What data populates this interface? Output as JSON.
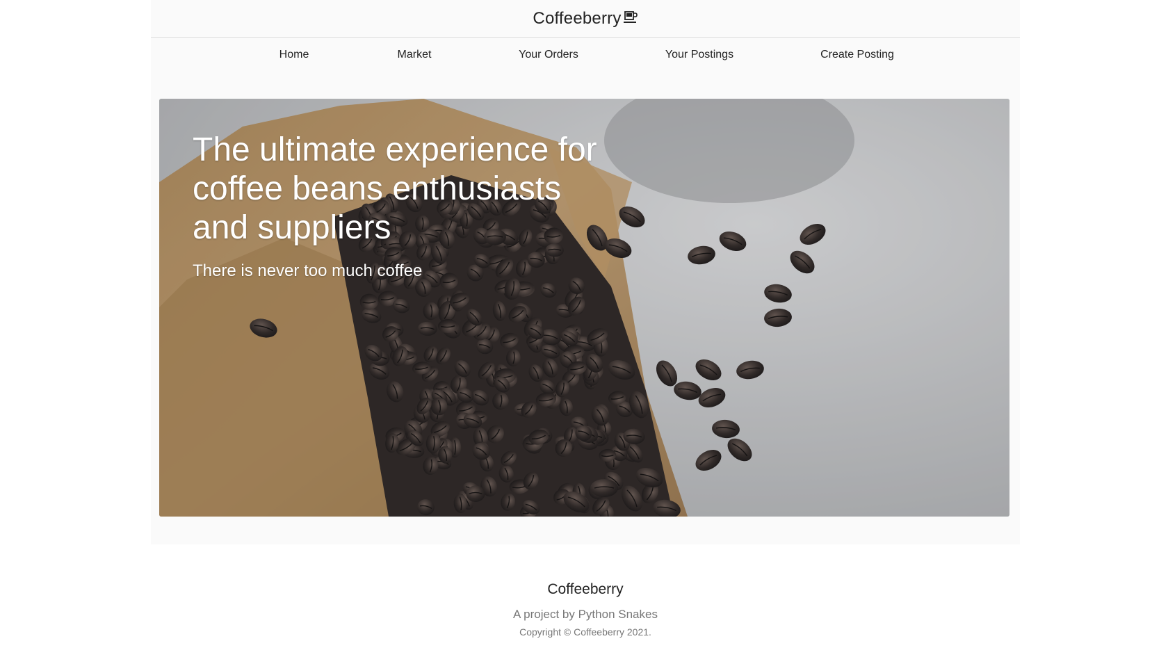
{
  "header": {
    "brand": "Coffeeberry",
    "brand_icon": "coffee-cup-icon"
  },
  "nav": {
    "items": [
      {
        "label": "Home"
      },
      {
        "label": "Market"
      },
      {
        "label": "Your Orders"
      },
      {
        "label": "Your Postings"
      },
      {
        "label": "Create Posting"
      }
    ]
  },
  "hero": {
    "title": "The ultimate experience for coffee beans enthusiasts and suppliers",
    "subtitle": "There is never too much coffee"
  },
  "footer": {
    "title": "Coffeeberry",
    "subtitle": "A project by Python Snakes",
    "copyright": "Copyright © Coffeeberry 2021."
  },
  "colors": {
    "page_background": "#fafafa",
    "text": "#222222",
    "muted_text": "#777777",
    "hero_text": "#ffffff"
  }
}
